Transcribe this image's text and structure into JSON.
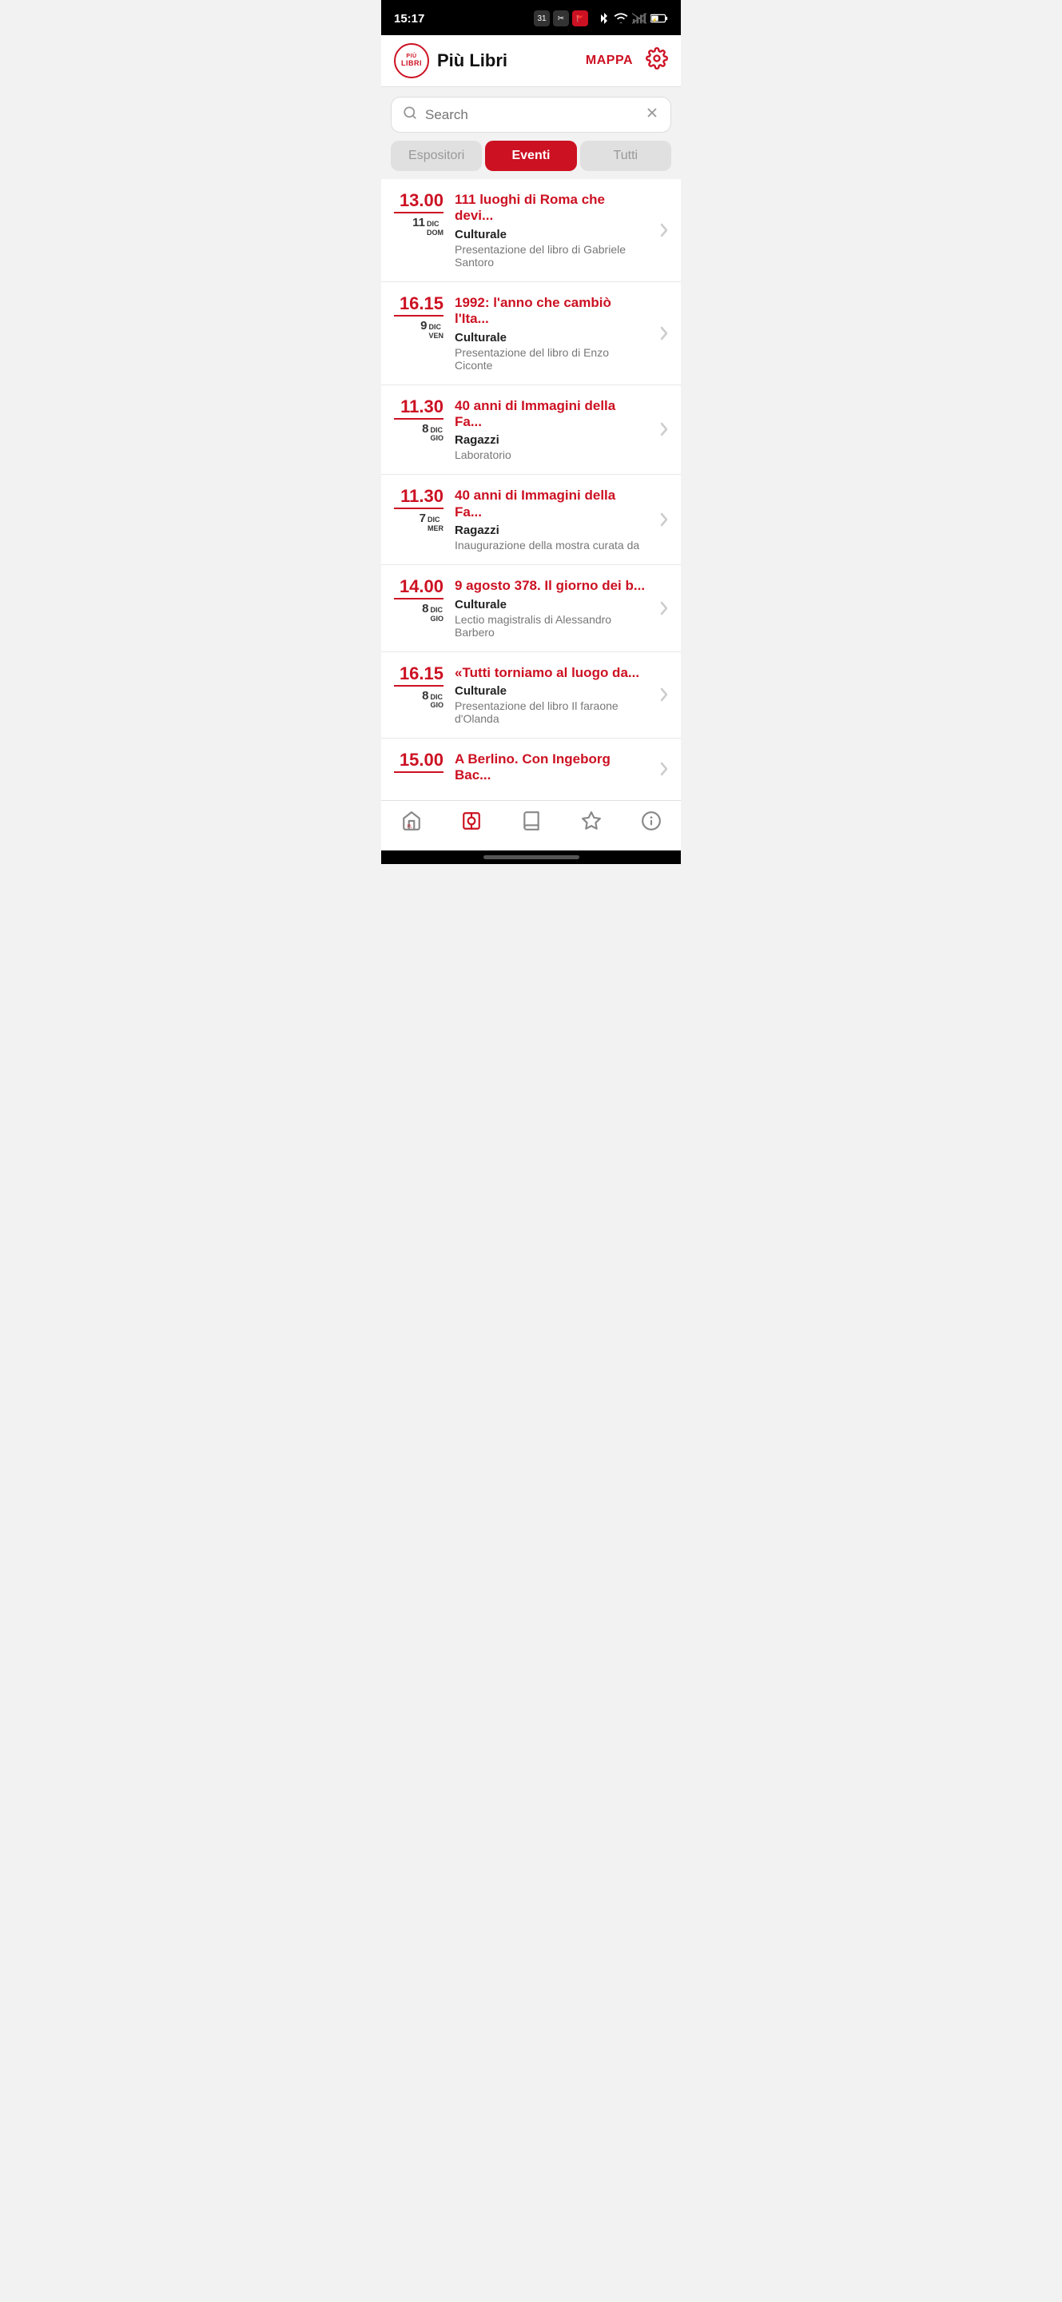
{
  "statusBar": {
    "time": "15:17"
  },
  "header": {
    "logoTopText": "PIÙ",
    "logoBottomText": "LIBRI",
    "appName": "Più Libri",
    "mappaLabel": "MAPPA"
  },
  "search": {
    "placeholder": "Search"
  },
  "tabs": [
    {
      "id": "espositori",
      "label": "Espositori",
      "active": false
    },
    {
      "id": "eventi",
      "label": "Eventi",
      "active": true
    },
    {
      "id": "tutti",
      "label": "Tutti",
      "active": false
    }
  ],
  "events": [
    {
      "time": "13.00",
      "dateNum": "11",
      "dateMonth": "DIC",
      "dateDay": "dom",
      "title": "111 luoghi di Roma che devi...",
      "category": "Culturale",
      "description": "Presentazione del libro di Gabriele Santoro"
    },
    {
      "time": "16.15",
      "dateNum": "9",
      "dateMonth": "DIC",
      "dateDay": "ven",
      "title": "1992: l'anno che cambiò l'Ita...",
      "category": "Culturale",
      "description": "Presentazione del libro di Enzo Ciconte"
    },
    {
      "time": "11.30",
      "dateNum": "8",
      "dateMonth": "DIC",
      "dateDay": "gio",
      "title": "40 anni di Immagini della Fa...",
      "category": "Ragazzi",
      "description": "Laboratorio"
    },
    {
      "time": "11.30",
      "dateNum": "7",
      "dateMonth": "DIC",
      "dateDay": "mer",
      "title": "40 anni di Immagini della Fa...",
      "category": "Ragazzi",
      "description": "Inaugurazione della mostra curata da"
    },
    {
      "time": "14.00",
      "dateNum": "8",
      "dateMonth": "DIC",
      "dateDay": "gio",
      "title": "9 agosto 378. Il giorno dei b...",
      "category": "Culturale",
      "description": "Lectio magistralis di Alessandro Barbero"
    },
    {
      "time": "16.15",
      "dateNum": "8",
      "dateMonth": "DIC",
      "dateDay": "gio",
      "title": "«Tutti torniamo al luogo da...",
      "category": "Culturale",
      "description": "Presentazione del libro Il faraone d'Olanda"
    },
    {
      "time": "15.00",
      "dateNum": "",
      "dateMonth": "",
      "dateDay": "",
      "title": "A Berlino. Con Ingeborg Bac...",
      "category": "",
      "description": ""
    }
  ],
  "bottomNav": [
    {
      "id": "home",
      "label": "Home",
      "icon": "home",
      "active": false
    },
    {
      "id": "events",
      "label": "Events",
      "icon": "badge",
      "active": true
    },
    {
      "id": "catalog",
      "label": "Catalog",
      "icon": "book",
      "active": false
    },
    {
      "id": "favorites",
      "label": "Favorites",
      "icon": "star",
      "active": false
    },
    {
      "id": "info",
      "label": "Info",
      "icon": "info",
      "active": false
    }
  ]
}
